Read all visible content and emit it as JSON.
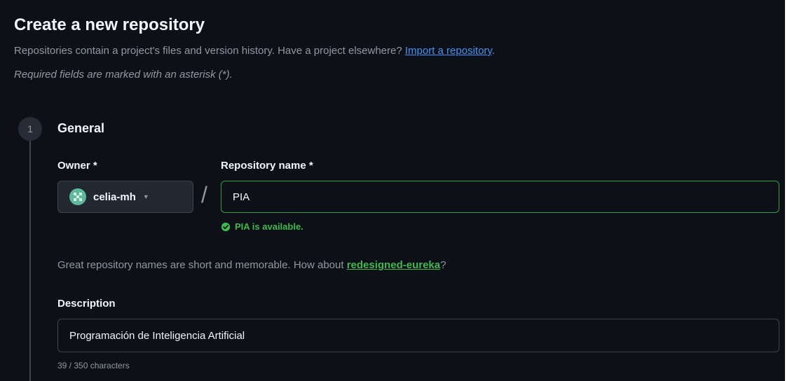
{
  "header": {
    "title": "Create a new repository",
    "intro_text": "Repositories contain a project's files and version history. Have a project elsewhere?",
    "import_link": "Import a repository",
    "intro_end": ".",
    "required_note": "Required fields are marked with an asterisk (*)."
  },
  "step": {
    "number": "1",
    "title": "General"
  },
  "owner": {
    "label": "Owner *",
    "value": "celia-mh"
  },
  "separator": "/",
  "repo_name": {
    "label": "Repository name *",
    "value": "PIA",
    "availability": "PIA is available."
  },
  "suggestion": {
    "text": "Great repository names are short and memorable. How about",
    "name": "redesigned-eureka",
    "end": "?"
  },
  "description": {
    "label": "Description",
    "value": "Programación de Inteligencia Artificial",
    "char_count": "39 / 350 characters"
  },
  "colors": {
    "background": "#0d1117",
    "success": "#3fb950",
    "link": "#4493f8",
    "muted": "#9198a1"
  },
  "icons": {
    "owner_avatar": "avatar-icon",
    "dropdown": "chevron-down-icon",
    "available": "check-circle-icon"
  }
}
